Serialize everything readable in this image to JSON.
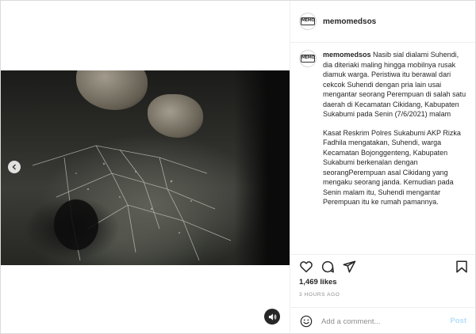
{
  "post": {
    "username": "memomedsos",
    "avatar_logo_text": "MEMO",
    "caption_user": "memomedsos",
    "caption_lead": "Nasib sial dialami Suhendi, dia diteriaki maling hingga mobilnya rusak diamuk warga. Peristiwa itu berawal dari cekcok Suhendi dengan pria lain usai mengantar seorang Perempuan di salah satu daerah di Kecamatan Cikidang, Kabupaten Sukabumi pada Senin (7/6/2021) malam",
    "caption_para2": "Kasat Reskrim Polres Sukabumi AKP Rizka Fadhila mengatakan, Suhendi, warga Kecamatan Bojonggenteng, Kabupaten Sukabumi berkenalan dengan seorangPerempuan asal Cikidang yang mengaku seorang janda. Kemudian pada Senin malam itu, Suhendi mengantar Perempuan itu ke rumah pamannya.",
    "likes": "1,469 likes",
    "timestamp": "3 HOURS AGO"
  },
  "media": {
    "prev_icon": "chevron-left-icon",
    "audio_icon": "speaker-icon"
  },
  "actions": {
    "like_icon": "heart-icon",
    "comment_icon": "comment-icon",
    "share_icon": "paper-plane-icon",
    "save_icon": "bookmark-icon"
  },
  "comment": {
    "placeholder": "Add a comment...",
    "post_label": "Post",
    "emoji_icon": "smiley-icon"
  },
  "colors": {
    "post_button": "#b2dffc",
    "muted_text": "#8e8e8e",
    "border": "#dbdbdb"
  }
}
